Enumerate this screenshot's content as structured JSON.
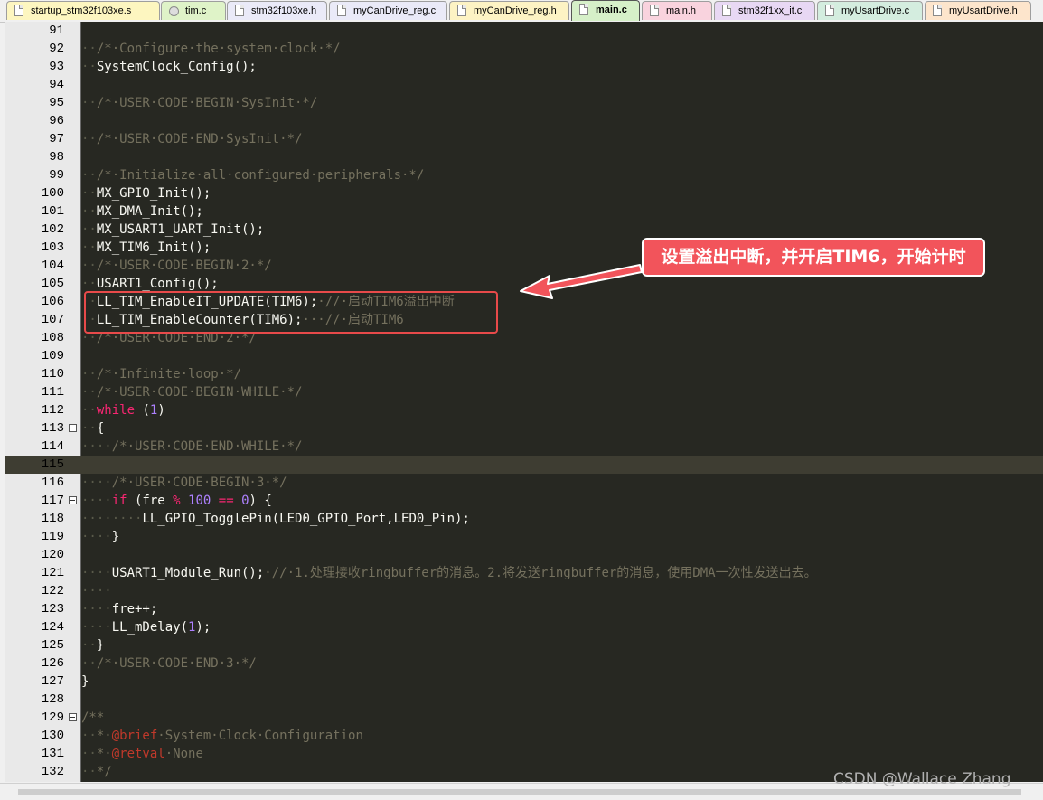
{
  "tabs": [
    {
      "label": "startup_stm32f103xe.s",
      "color": "#fdf6c0",
      "icon": "asm-file-icon"
    },
    {
      "label": "tim.c",
      "color": "#dff3c8",
      "icon": "gear-file-icon"
    },
    {
      "label": "stm32f103xe.h",
      "color": "#eaeaf8",
      "icon": "header-file-icon"
    },
    {
      "label": "myCanDrive_reg.c",
      "color": "#eaeaf8",
      "icon": "c-file-icon"
    },
    {
      "label": "myCanDrive_reg.h",
      "color": "#fdf3c4",
      "icon": "header-file-icon"
    },
    {
      "label": "main.c",
      "color": "#d6f0c8",
      "icon": "c-file-icon",
      "active": true
    },
    {
      "label": "main.h",
      "color": "#f9d3de",
      "icon": "header-file-icon"
    },
    {
      "label": "stm32f1xx_it.c",
      "color": "#e8d8f4",
      "icon": "c-file-icon"
    },
    {
      "label": "myUsartDrive.c",
      "color": "#d4eddf",
      "icon": "c-file-icon"
    },
    {
      "label": "myUsartDrive.h",
      "color": "#fde5cc",
      "icon": "header-file-icon"
    }
  ],
  "code_lines": [
    {
      "n": "91",
      "tokens": []
    },
    {
      "n": "92",
      "tokens": [
        [
          "ws",
          "··"
        ],
        [
          "cmt",
          "/*·Configure·the·system·clock·*/"
        ]
      ]
    },
    {
      "n": "93",
      "tokens": [
        [
          "ws",
          "··"
        ],
        [
          "plain",
          "SystemClock_Config();"
        ]
      ]
    },
    {
      "n": "94",
      "tokens": []
    },
    {
      "n": "95",
      "tokens": [
        [
          "ws",
          "··"
        ],
        [
          "cmt",
          "/*·USER·CODE·BEGIN·SysInit·*/"
        ]
      ]
    },
    {
      "n": "96",
      "tokens": []
    },
    {
      "n": "97",
      "tokens": [
        [
          "ws",
          "··"
        ],
        [
          "cmt",
          "/*·USER·CODE·END·SysInit·*/"
        ]
      ]
    },
    {
      "n": "98",
      "tokens": []
    },
    {
      "n": "99",
      "tokens": [
        [
          "ws",
          "··"
        ],
        [
          "cmt",
          "/*·Initialize·all·configured·peripherals·*/"
        ]
      ]
    },
    {
      "n": "100",
      "tokens": [
        [
          "ws",
          "··"
        ],
        [
          "plain",
          "MX_GPIO_Init();"
        ]
      ]
    },
    {
      "n": "101",
      "tokens": [
        [
          "ws",
          "··"
        ],
        [
          "plain",
          "MX_DMA_Init();"
        ]
      ]
    },
    {
      "n": "102",
      "tokens": [
        [
          "ws",
          "··"
        ],
        [
          "plain",
          "MX_USART1_UART_Init();"
        ]
      ]
    },
    {
      "n": "103",
      "tokens": [
        [
          "ws",
          "··"
        ],
        [
          "plain",
          "MX_TIM6_Init();"
        ]
      ]
    },
    {
      "n": "104",
      "tokens": [
        [
          "ws",
          "··"
        ],
        [
          "cmt",
          "/*·USER·CODE·BEGIN·2·*/"
        ]
      ]
    },
    {
      "n": "105",
      "tokens": [
        [
          "ws",
          "··"
        ],
        [
          "plain",
          "USART1_Config();"
        ]
      ]
    },
    {
      "n": "106",
      "tokens": [
        [
          "ws",
          "··"
        ],
        [
          "plain",
          "LL_TIM_EnableIT_UPDATE(TIM6);"
        ],
        [
          "cmt",
          "·//·启动TIM6溢出中断"
        ]
      ]
    },
    {
      "n": "107",
      "tokens": [
        [
          "ws",
          "··"
        ],
        [
          "plain",
          "LL_TIM_EnableCounter(TIM6);"
        ],
        [
          "cmt",
          "···//·启动TIM6"
        ]
      ]
    },
    {
      "n": "108",
      "tokens": [
        [
          "ws",
          "··"
        ],
        [
          "cmt",
          "/*·USER·CODE·END·2·*/"
        ]
      ]
    },
    {
      "n": "109",
      "tokens": []
    },
    {
      "n": "110",
      "tokens": [
        [
          "ws",
          "··"
        ],
        [
          "cmt",
          "/*·Infinite·loop·*/"
        ]
      ]
    },
    {
      "n": "111",
      "tokens": [
        [
          "ws",
          "··"
        ],
        [
          "cmt",
          "/*·USER·CODE·BEGIN·WHILE·*/"
        ]
      ]
    },
    {
      "n": "112",
      "tokens": [
        [
          "ws",
          "··"
        ],
        [
          "kw",
          "while"
        ],
        [
          "plain",
          " ("
        ],
        [
          "num",
          "1"
        ],
        [
          "plain",
          ")"
        ]
      ]
    },
    {
      "n": "113",
      "tokens": [
        [
          "ws",
          "··"
        ],
        [
          "plain",
          "{"
        ]
      ],
      "fold": true
    },
    {
      "n": "114",
      "tokens": [
        [
          "ws",
          "····"
        ],
        [
          "cmt",
          "/*·USER·CODE·END·WHILE·*/"
        ]
      ]
    },
    {
      "n": "115",
      "tokens": [],
      "current": true
    },
    {
      "n": "116",
      "tokens": [
        [
          "ws",
          "····"
        ],
        [
          "cmt",
          "/*·USER·CODE·BEGIN·3·*/"
        ]
      ]
    },
    {
      "n": "117",
      "tokens": [
        [
          "ws",
          "····"
        ],
        [
          "kw",
          "if"
        ],
        [
          "plain",
          " (fre "
        ],
        [
          "kw",
          "%"
        ],
        [
          "plain",
          " "
        ],
        [
          "num",
          "100"
        ],
        [
          "plain",
          " "
        ],
        [
          "kw",
          "=="
        ],
        [
          "plain",
          " "
        ],
        [
          "num",
          "0"
        ],
        [
          "plain",
          ") {"
        ]
      ],
      "fold": true
    },
    {
      "n": "118",
      "tokens": [
        [
          "ws",
          "········"
        ],
        [
          "plain",
          "LL_GPIO_TogglePin(LED0_GPIO_Port,LED0_Pin);"
        ]
      ]
    },
    {
      "n": "119",
      "tokens": [
        [
          "ws",
          "····"
        ],
        [
          "plain",
          "}"
        ]
      ]
    },
    {
      "n": "120",
      "tokens": []
    },
    {
      "n": "121",
      "tokens": [
        [
          "ws",
          "····"
        ],
        [
          "plain",
          "USART1_Module_Run();"
        ],
        [
          "cmt",
          "·//·1.处理接收ringbuffer的消息。2.将发送ringbuffer的消息，使用DMA一次性发送出去。"
        ]
      ]
    },
    {
      "n": "122",
      "tokens": [
        [
          "ws",
          "····"
        ]
      ]
    },
    {
      "n": "123",
      "tokens": [
        [
          "ws",
          "····"
        ],
        [
          "plain",
          "fre++;"
        ]
      ]
    },
    {
      "n": "124",
      "tokens": [
        [
          "ws",
          "····"
        ],
        [
          "plain",
          "LL_mDelay("
        ],
        [
          "num",
          "1"
        ],
        [
          "plain",
          ");"
        ]
      ]
    },
    {
      "n": "125",
      "tokens": [
        [
          "ws",
          "··"
        ],
        [
          "plain",
          "}"
        ]
      ]
    },
    {
      "n": "126",
      "tokens": [
        [
          "ws",
          "··"
        ],
        [
          "cmt",
          "/*·USER·CODE·END·3·*/"
        ]
      ]
    },
    {
      "n": "127",
      "tokens": [
        [
          "plain",
          "}"
        ]
      ]
    },
    {
      "n": "128",
      "tokens": []
    },
    {
      "n": "129",
      "tokens": [
        [
          "cmt",
          "/**"
        ]
      ],
      "fold": true
    },
    {
      "n": "130",
      "tokens": [
        [
          "ws",
          "··"
        ],
        [
          "cmt",
          "*·"
        ],
        [
          "tag",
          "@brief"
        ],
        [
          "cmt",
          "·System·Clock·Configuration"
        ]
      ]
    },
    {
      "n": "131",
      "tokens": [
        [
          "ws",
          "··"
        ],
        [
          "cmt",
          "*·"
        ],
        [
          "tag",
          "@retval"
        ],
        [
          "cmt",
          "·None"
        ]
      ]
    },
    {
      "n": "132",
      "tokens": [
        [
          "ws",
          "··"
        ],
        [
          "cmt",
          "*/"
        ]
      ]
    }
  ],
  "annotation": {
    "callout_text": "设置溢出中断，并开启TIM6，开始计时",
    "color": "#f2545b"
  },
  "watermark": "CSDN @Wallace Zhang"
}
